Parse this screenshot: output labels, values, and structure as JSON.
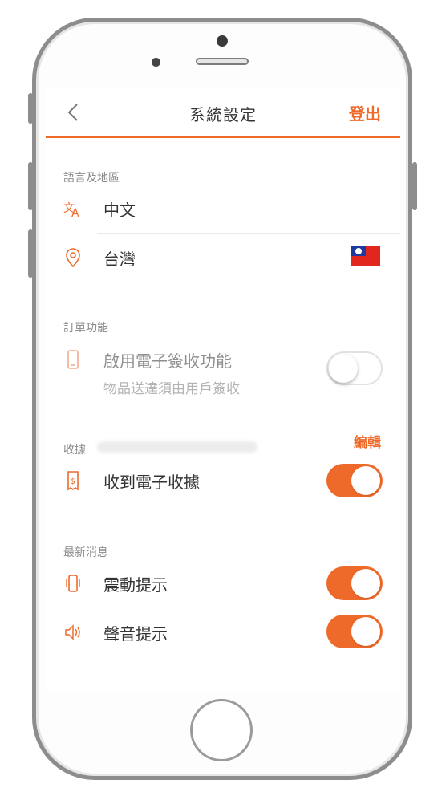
{
  "header": {
    "title": "系統設定",
    "logout_label": "登出"
  },
  "language_region": {
    "section_label": "語言及地區",
    "language": "中文",
    "region": "台灣"
  },
  "order_features": {
    "section_label": "訂單功能",
    "esign_label": "啟用電子簽收功能",
    "esign_desc": "物品送達須由用戶簽收",
    "esign_enabled": false
  },
  "receipt": {
    "section_label": "收據",
    "edit_label": "編輯",
    "ereceipt_label": "收到電子收據",
    "ereceipt_enabled": true
  },
  "news": {
    "section_label": "最新消息",
    "vibrate_label": "震動提示",
    "vibrate_enabled": true,
    "sound_label": "聲音提示",
    "sound_enabled": true
  },
  "colors": {
    "accent": "#ee6a2b"
  }
}
